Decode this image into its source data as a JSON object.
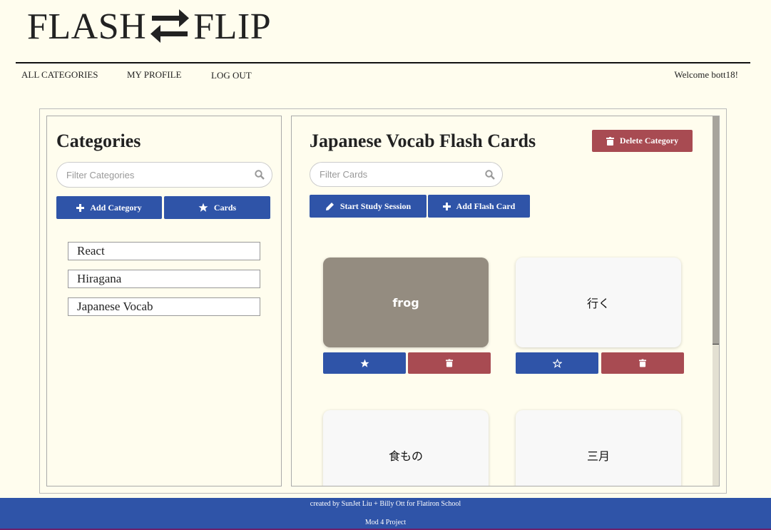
{
  "brand": {
    "left": "FLASH",
    "right": "FLIP",
    "icon": "swap-arrows-icon"
  },
  "nav": {
    "items": [
      "ALL CATEGORIES",
      "MY PROFILE",
      "LOG OUT"
    ],
    "welcome": "Welcome bott18!"
  },
  "sidebar": {
    "title": "Categories",
    "filter_placeholder": "Filter Categories",
    "add_category_label": "Add Category",
    "cards_label": "Cards",
    "categories": [
      "React",
      "Hiragana",
      "Japanese Vocab"
    ]
  },
  "main": {
    "title": "Japanese Vocab Flash Cards",
    "delete_label": "Delete Category",
    "filter_placeholder": "Filter Cards",
    "study_label": "Start Study Session",
    "add_card_label": "Add Flash Card",
    "cards": [
      {
        "text": "frog",
        "flipped": true,
        "starred": true
      },
      {
        "text": "行く",
        "flipped": false,
        "starred": false
      },
      {
        "text": "食もの",
        "flipped": false,
        "starred": false
      },
      {
        "text": "三月",
        "flipped": false,
        "starred": false
      }
    ]
  },
  "footer": {
    "credit": "created by SunJet Liu + Billy Ott for Flatiron School",
    "project": "Mod 4 Project"
  },
  "colors": {
    "background": "#fffdee",
    "primary": "#2f54a8",
    "danger": "#a84b52",
    "flipped_card": "#948c80"
  }
}
